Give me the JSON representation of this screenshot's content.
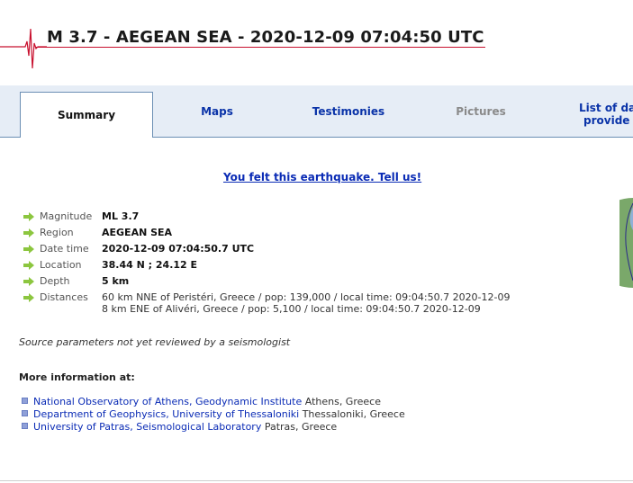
{
  "header": {
    "title": "M 3.7 - AEGEAN SEA - 2020-12-09 07:04:50 UTC"
  },
  "tabs": [
    {
      "label": "Summary",
      "state": "active"
    },
    {
      "label": "Maps",
      "state": "link"
    },
    {
      "label": "Testimonies",
      "state": "link"
    },
    {
      "label": "Pictures",
      "state": "disabled"
    },
    {
      "label_line1": "List of da",
      "label_line2": "provide",
      "state": "link"
    }
  ],
  "felt_link": "You felt this earthquake. Tell us!",
  "parameters": [
    {
      "label": "Magnitude",
      "value": "ML 3.7"
    },
    {
      "label": "Region",
      "value": "AEGEAN SEA"
    },
    {
      "label": "Date time",
      "value": "2020-12-09 07:04:50.7 UTC"
    },
    {
      "label": "Location",
      "value": "38.44 N ; 24.12 E"
    },
    {
      "label": "Depth",
      "value": "5 km"
    },
    {
      "label": "Distances",
      "line1": "60 km NNE of Peristéri, Greece / pop: 139,000 / local time: 09:04:50.7 2020-12-09",
      "line2": "8 km ENE of Alivéri, Greece / pop: 5,100 / local time: 09:04:50.7 2020-12-09"
    }
  ],
  "source_note": "Source parameters not yet reviewed by a seismologist",
  "more_info_heading": "More information at:",
  "more_info_links": [
    {
      "name": "National Observatory of Athens, Geodynamic Institute",
      "location": " Athens, Greece"
    },
    {
      "name": "Department of Geophysics, University of Thessaloniki",
      "location": " Thessaloniki, Greece"
    },
    {
      "name": "University of Patras, Seismological Laboratory",
      "location": " Patras, Greece"
    }
  ],
  "colors": {
    "accent_red": "#c8102e",
    "link_blue": "#0a2bb5",
    "tabbar_bg": "#e6edf6",
    "arrow_green": "#8cc63f"
  }
}
